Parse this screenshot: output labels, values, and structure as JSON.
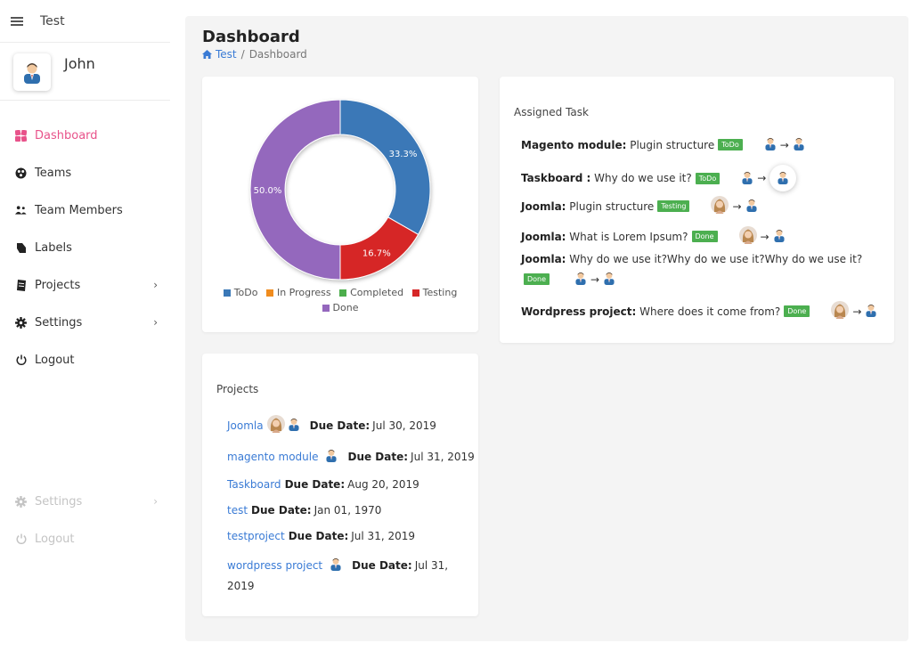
{
  "app": {
    "title": "Test"
  },
  "user": {
    "name": "John"
  },
  "sidebar": {
    "items": [
      {
        "label": "Dashboard",
        "icon": "dashboard-icon",
        "active": true
      },
      {
        "label": "Teams",
        "icon": "teams-icon"
      },
      {
        "label": "Team Members",
        "icon": "team-members-icon"
      },
      {
        "label": "Labels",
        "icon": "tag-icon"
      },
      {
        "label": "Projects",
        "icon": "projects-icon",
        "chevron": true
      },
      {
        "label": "Settings",
        "icon": "gear-icon",
        "chevron": true
      },
      {
        "label": "Logout",
        "icon": "power-icon"
      }
    ],
    "bottom_items": [
      {
        "label": "Settings",
        "icon": "gear-icon",
        "chevron": true
      },
      {
        "label": "Logout",
        "icon": "power-icon"
      }
    ],
    "chevron_glyph": "›"
  },
  "page": {
    "title": "Dashboard",
    "breadcrumb": {
      "root": "Test",
      "separator": "/",
      "current": "Dashboard"
    }
  },
  "chart_data": {
    "type": "pie",
    "donut": true,
    "slices": [
      {
        "label": "ToDo",
        "value": 33.3,
        "display": "33.3%",
        "color": "#3a78b7"
      },
      {
        "label": "In Progress",
        "value": 0,
        "display": "",
        "color": "#f08c1e"
      },
      {
        "label": "Completed",
        "value": 0,
        "display": "",
        "color": "#4cae4c"
      },
      {
        "label": "Testing",
        "value": 16.7,
        "display": "16.7%",
        "color": "#d62728"
      },
      {
        "label": "Done",
        "value": 50.0,
        "display": "50.0%",
        "color": "#9467bd"
      }
    ],
    "legend": [
      "ToDo",
      "In Progress",
      "Completed",
      "Testing",
      "Done"
    ],
    "legend_placement": "bottom"
  },
  "tasks": {
    "title": "Assigned Task",
    "items": [
      {
        "project": "Magento module:",
        "text": "Plugin structure",
        "status": "ToDo",
        "from": "male",
        "to": "male"
      },
      {
        "project": "Taskboard :",
        "text": "Why do we use it?",
        "status": "ToDo",
        "from": "male",
        "to": "male",
        "highlight": true
      },
      {
        "project": "Joomla:",
        "text": "Plugin structure",
        "status": "Testing",
        "from": "female",
        "to": "male"
      },
      {
        "project": "Joomla:",
        "text": "What is Lorem Ipsum?",
        "status": "Done",
        "from": "female",
        "to": "male"
      },
      {
        "project": "Joomla:",
        "text": "Why do we use it?Why do we use it?Why do we use it?",
        "status": "Done",
        "from": "male",
        "to": "male"
      },
      {
        "project": "Wordpress project:",
        "text": "Where does it come from?",
        "status": "Done",
        "from": "female",
        "to": "male"
      }
    ],
    "arrow": "→"
  },
  "projects": {
    "title": "Projects",
    "due_label": "Due Date:",
    "items": [
      {
        "name": "Joomla",
        "due": "Jul 30, 2019",
        "members": [
          "female",
          "male"
        ]
      },
      {
        "name": "magento module",
        "due": "Jul 31, 2019",
        "members": [
          "male"
        ]
      },
      {
        "name": "Taskboard",
        "due": "Aug 20, 2019",
        "members": []
      },
      {
        "name": "test",
        "due": "Jan 01, 1970",
        "members": []
      },
      {
        "name": "testproject",
        "due": "Jul 31, 2019",
        "members": []
      },
      {
        "name": "wordpress project",
        "due_line1": "Jul 31,",
        "due_line2": "2019",
        "members": [
          "male"
        ]
      }
    ]
  }
}
